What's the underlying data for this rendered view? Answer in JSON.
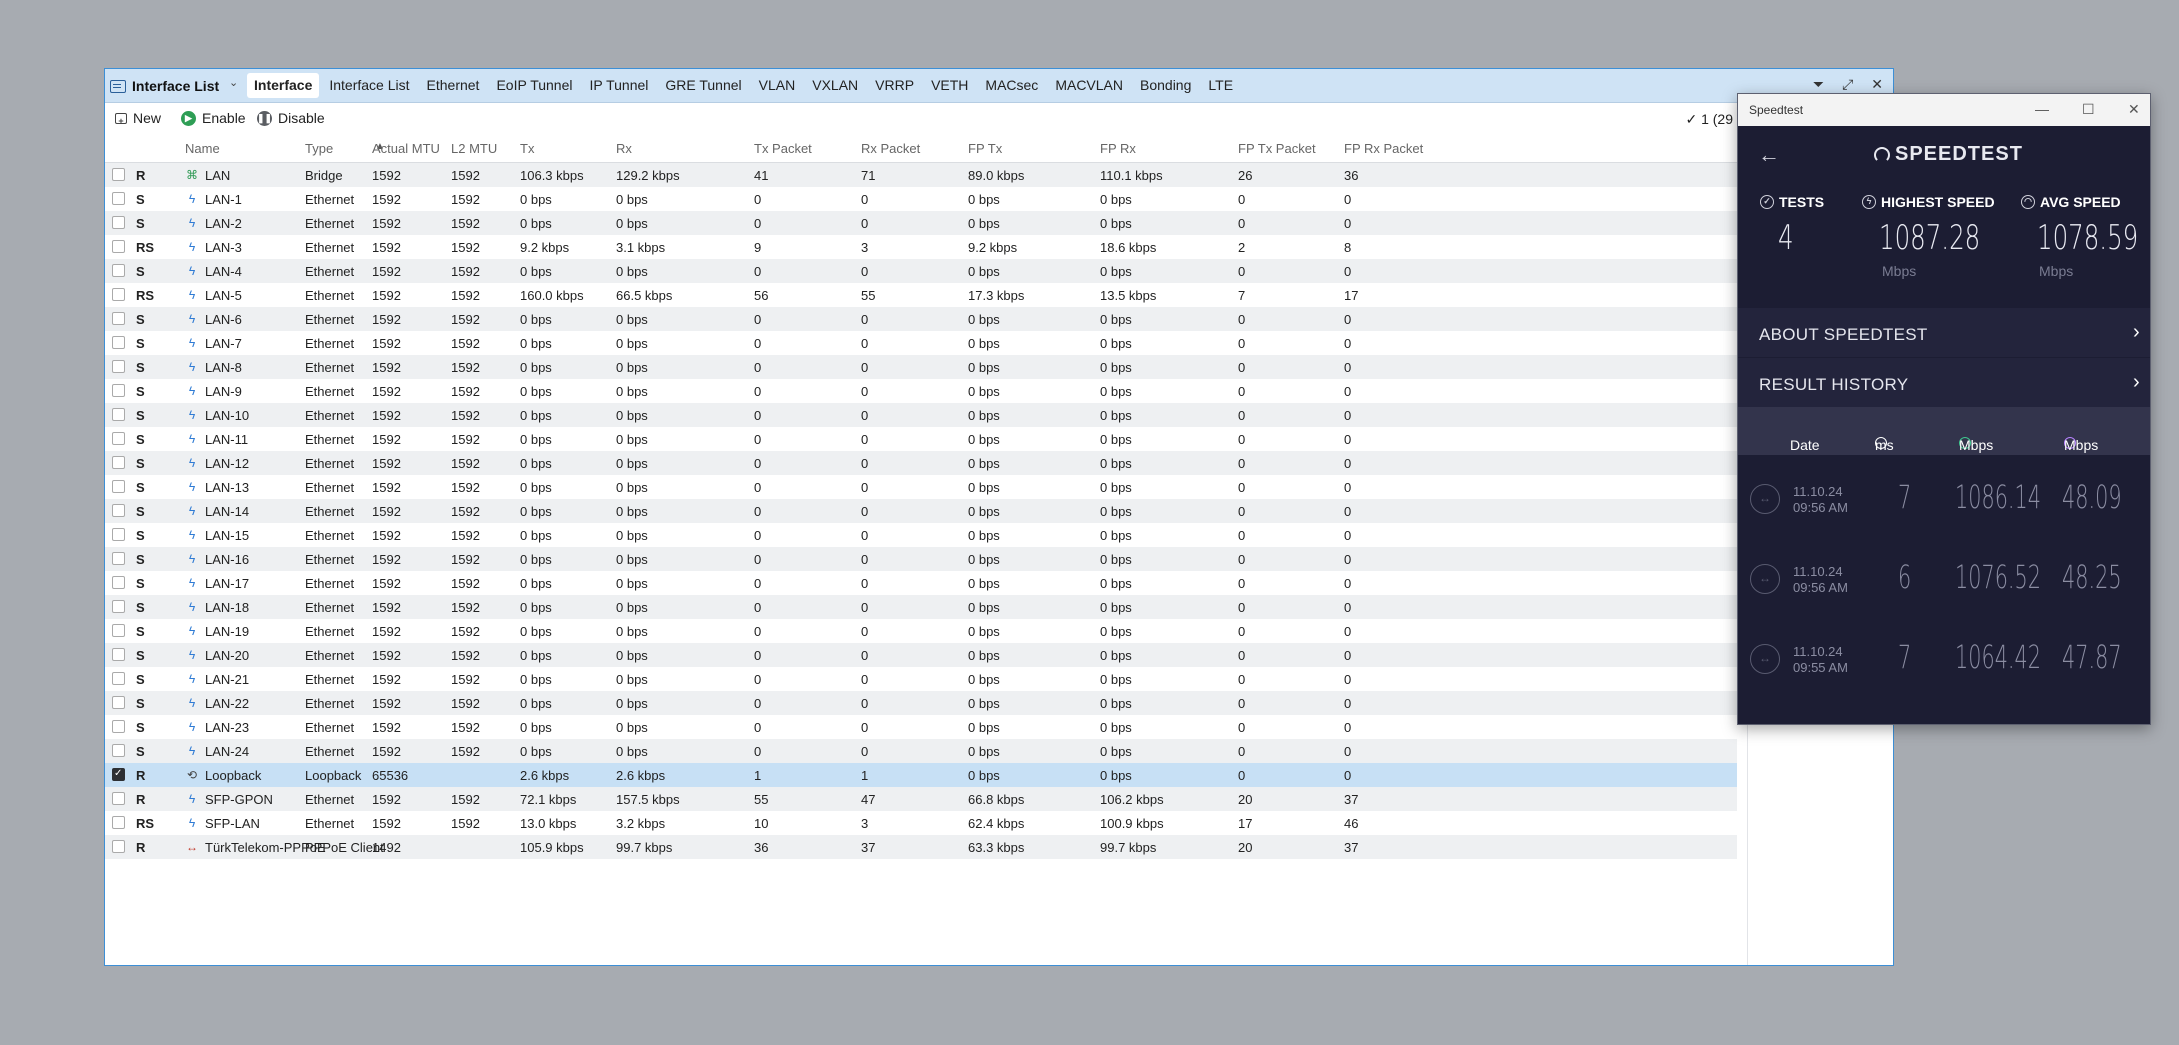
{
  "interface_window": {
    "title": "Interface List",
    "tabs": [
      "Interface",
      "Interface List",
      "Ethernet",
      "EoIP Tunnel",
      "IP Tunnel",
      "GRE Tunnel",
      "VLAN",
      "VXLAN",
      "VRRP",
      "VETH",
      "MACsec",
      "MACVLAN",
      "Bonding",
      "LTE"
    ],
    "active_tab": "Interface",
    "toolbar": {
      "new": "New",
      "enable": "Enable",
      "disable": "Disable",
      "count": "✓ 1 (29"
    },
    "columns": [
      "Name",
      "Type",
      "Actual MTU",
      "L2 MTU",
      "Tx",
      "Rx",
      "Tx Packet",
      "Rx Packet",
      "FP Tx",
      "FP Rx",
      "FP Tx Packet",
      "FP Rx Packet"
    ],
    "rows": [
      {
        "flags": "R",
        "icon": "bridge-icon",
        "name": "LAN",
        "type": "Bridge",
        "mtu": "1592",
        "l2": "1592",
        "tx": "106.3 kbps",
        "rx": "129.2 kbps",
        "txp": "41",
        "rxp": "71",
        "fptx": "89.0 kbps",
        "fprx": "110.1 kbps",
        "fptxp": "26",
        "fprxp": "36"
      },
      {
        "flags": "S",
        "icon": "ethernet-icon",
        "name": "LAN-1",
        "type": "Ethernet",
        "mtu": "1592",
        "l2": "1592",
        "tx": "0 bps",
        "rx": "0 bps",
        "txp": "0",
        "rxp": "0",
        "fptx": "0 bps",
        "fprx": "0 bps",
        "fptxp": "0",
        "fprxp": "0"
      },
      {
        "flags": "S",
        "icon": "ethernet-icon",
        "name": "LAN-2",
        "type": "Ethernet",
        "mtu": "1592",
        "l2": "1592",
        "tx": "0 bps",
        "rx": "0 bps",
        "txp": "0",
        "rxp": "0",
        "fptx": "0 bps",
        "fprx": "0 bps",
        "fptxp": "0",
        "fprxp": "0"
      },
      {
        "flags": "RS",
        "icon": "ethernet-icon",
        "name": "LAN-3",
        "type": "Ethernet",
        "mtu": "1592",
        "l2": "1592",
        "tx": "9.2 kbps",
        "rx": "3.1 kbps",
        "txp": "9",
        "rxp": "3",
        "fptx": "9.2 kbps",
        "fprx": "18.6 kbps",
        "fptxp": "2",
        "fprxp": "8"
      },
      {
        "flags": "S",
        "icon": "ethernet-icon",
        "name": "LAN-4",
        "type": "Ethernet",
        "mtu": "1592",
        "l2": "1592",
        "tx": "0 bps",
        "rx": "0 bps",
        "txp": "0",
        "rxp": "0",
        "fptx": "0 bps",
        "fprx": "0 bps",
        "fptxp": "0",
        "fprxp": "0"
      },
      {
        "flags": "RS",
        "icon": "ethernet-icon",
        "name": "LAN-5",
        "type": "Ethernet",
        "mtu": "1592",
        "l2": "1592",
        "tx": "160.0 kbps",
        "rx": "66.5 kbps",
        "txp": "56",
        "rxp": "55",
        "fptx": "17.3 kbps",
        "fprx": "13.5 kbps",
        "fptxp": "7",
        "fprxp": "17"
      },
      {
        "flags": "S",
        "icon": "ethernet-icon",
        "name": "LAN-6",
        "type": "Ethernet",
        "mtu": "1592",
        "l2": "1592",
        "tx": "0 bps",
        "rx": "0 bps",
        "txp": "0",
        "rxp": "0",
        "fptx": "0 bps",
        "fprx": "0 bps",
        "fptxp": "0",
        "fprxp": "0"
      },
      {
        "flags": "S",
        "icon": "ethernet-icon",
        "name": "LAN-7",
        "type": "Ethernet",
        "mtu": "1592",
        "l2": "1592",
        "tx": "0 bps",
        "rx": "0 bps",
        "txp": "0",
        "rxp": "0",
        "fptx": "0 bps",
        "fprx": "0 bps",
        "fptxp": "0",
        "fprxp": "0"
      },
      {
        "flags": "S",
        "icon": "ethernet-icon",
        "name": "LAN-8",
        "type": "Ethernet",
        "mtu": "1592",
        "l2": "1592",
        "tx": "0 bps",
        "rx": "0 bps",
        "txp": "0",
        "rxp": "0",
        "fptx": "0 bps",
        "fprx": "0 bps",
        "fptxp": "0",
        "fprxp": "0"
      },
      {
        "flags": "S",
        "icon": "ethernet-icon",
        "name": "LAN-9",
        "type": "Ethernet",
        "mtu": "1592",
        "l2": "1592",
        "tx": "0 bps",
        "rx": "0 bps",
        "txp": "0",
        "rxp": "0",
        "fptx": "0 bps",
        "fprx": "0 bps",
        "fptxp": "0",
        "fprxp": "0"
      },
      {
        "flags": "S",
        "icon": "ethernet-icon",
        "name": "LAN-10",
        "type": "Ethernet",
        "mtu": "1592",
        "l2": "1592",
        "tx": "0 bps",
        "rx": "0 bps",
        "txp": "0",
        "rxp": "0",
        "fptx": "0 bps",
        "fprx": "0 bps",
        "fptxp": "0",
        "fprxp": "0"
      },
      {
        "flags": "S",
        "icon": "ethernet-icon",
        "name": "LAN-11",
        "type": "Ethernet",
        "mtu": "1592",
        "l2": "1592",
        "tx": "0 bps",
        "rx": "0 bps",
        "txp": "0",
        "rxp": "0",
        "fptx": "0 bps",
        "fprx": "0 bps",
        "fptxp": "0",
        "fprxp": "0"
      },
      {
        "flags": "S",
        "icon": "ethernet-icon",
        "name": "LAN-12",
        "type": "Ethernet",
        "mtu": "1592",
        "l2": "1592",
        "tx": "0 bps",
        "rx": "0 bps",
        "txp": "0",
        "rxp": "0",
        "fptx": "0 bps",
        "fprx": "0 bps",
        "fptxp": "0",
        "fprxp": "0"
      },
      {
        "flags": "S",
        "icon": "ethernet-icon",
        "name": "LAN-13",
        "type": "Ethernet",
        "mtu": "1592",
        "l2": "1592",
        "tx": "0 bps",
        "rx": "0 bps",
        "txp": "0",
        "rxp": "0",
        "fptx": "0 bps",
        "fprx": "0 bps",
        "fptxp": "0",
        "fprxp": "0"
      },
      {
        "flags": "S",
        "icon": "ethernet-icon",
        "name": "LAN-14",
        "type": "Ethernet",
        "mtu": "1592",
        "l2": "1592",
        "tx": "0 bps",
        "rx": "0 bps",
        "txp": "0",
        "rxp": "0",
        "fptx": "0 bps",
        "fprx": "0 bps",
        "fptxp": "0",
        "fprxp": "0"
      },
      {
        "flags": "S",
        "icon": "ethernet-icon",
        "name": "LAN-15",
        "type": "Ethernet",
        "mtu": "1592",
        "l2": "1592",
        "tx": "0 bps",
        "rx": "0 bps",
        "txp": "0",
        "rxp": "0",
        "fptx": "0 bps",
        "fprx": "0 bps",
        "fptxp": "0",
        "fprxp": "0"
      },
      {
        "flags": "S",
        "icon": "ethernet-icon",
        "name": "LAN-16",
        "type": "Ethernet",
        "mtu": "1592",
        "l2": "1592",
        "tx": "0 bps",
        "rx": "0 bps",
        "txp": "0",
        "rxp": "0",
        "fptx": "0 bps",
        "fprx": "0 bps",
        "fptxp": "0",
        "fprxp": "0"
      },
      {
        "flags": "S",
        "icon": "ethernet-icon",
        "name": "LAN-17",
        "type": "Ethernet",
        "mtu": "1592",
        "l2": "1592",
        "tx": "0 bps",
        "rx": "0 bps",
        "txp": "0",
        "rxp": "0",
        "fptx": "0 bps",
        "fprx": "0 bps",
        "fptxp": "0",
        "fprxp": "0"
      },
      {
        "flags": "S",
        "icon": "ethernet-icon",
        "name": "LAN-18",
        "type": "Ethernet",
        "mtu": "1592",
        "l2": "1592",
        "tx": "0 bps",
        "rx": "0 bps",
        "txp": "0",
        "rxp": "0",
        "fptx": "0 bps",
        "fprx": "0 bps",
        "fptxp": "0",
        "fprxp": "0"
      },
      {
        "flags": "S",
        "icon": "ethernet-icon",
        "name": "LAN-19",
        "type": "Ethernet",
        "mtu": "1592",
        "l2": "1592",
        "tx": "0 bps",
        "rx": "0 bps",
        "txp": "0",
        "rxp": "0",
        "fptx": "0 bps",
        "fprx": "0 bps",
        "fptxp": "0",
        "fprxp": "0"
      },
      {
        "flags": "S",
        "icon": "ethernet-icon",
        "name": "LAN-20",
        "type": "Ethernet",
        "mtu": "1592",
        "l2": "1592",
        "tx": "0 bps",
        "rx": "0 bps",
        "txp": "0",
        "rxp": "0",
        "fptx": "0 bps",
        "fprx": "0 bps",
        "fptxp": "0",
        "fprxp": "0"
      },
      {
        "flags": "S",
        "icon": "ethernet-icon",
        "name": "LAN-21",
        "type": "Ethernet",
        "mtu": "1592",
        "l2": "1592",
        "tx": "0 bps",
        "rx": "0 bps",
        "txp": "0",
        "rxp": "0",
        "fptx": "0 bps",
        "fprx": "0 bps",
        "fptxp": "0",
        "fprxp": "0"
      },
      {
        "flags": "S",
        "icon": "ethernet-icon",
        "name": "LAN-22",
        "type": "Ethernet",
        "mtu": "1592",
        "l2": "1592",
        "tx": "0 bps",
        "rx": "0 bps",
        "txp": "0",
        "rxp": "0",
        "fptx": "0 bps",
        "fprx": "0 bps",
        "fptxp": "0",
        "fprxp": "0"
      },
      {
        "flags": "S",
        "icon": "ethernet-icon",
        "name": "LAN-23",
        "type": "Ethernet",
        "mtu": "1592",
        "l2": "1592",
        "tx": "0 bps",
        "rx": "0 bps",
        "txp": "0",
        "rxp": "0",
        "fptx": "0 bps",
        "fprx": "0 bps",
        "fptxp": "0",
        "fprxp": "0"
      },
      {
        "flags": "S",
        "icon": "ethernet-icon",
        "name": "LAN-24",
        "type": "Ethernet",
        "mtu": "1592",
        "l2": "1592",
        "tx": "0 bps",
        "rx": "0 bps",
        "txp": "0",
        "rxp": "0",
        "fptx": "0 bps",
        "fprx": "0 bps",
        "fptxp": "0",
        "fprxp": "0"
      },
      {
        "flags": "R",
        "icon": "loopback-icon",
        "name": "Loopback",
        "type": "Loopback",
        "mtu": "65536",
        "l2": "",
        "tx": "2.6 kbps",
        "rx": "2.6 kbps",
        "txp": "1",
        "rxp": "1",
        "fptx": "0 bps",
        "fprx": "0 bps",
        "fptxp": "0",
        "fprxp": "0",
        "selected": true
      },
      {
        "flags": "R",
        "icon": "ethernet-icon",
        "name": "SFP-GPON",
        "type": "Ethernet",
        "mtu": "1592",
        "l2": "1592",
        "tx": "72.1 kbps",
        "rx": "157.5 kbps",
        "txp": "55",
        "rxp": "47",
        "fptx": "66.8 kbps",
        "fprx": "106.2 kbps",
        "fptxp": "20",
        "fprxp": "37"
      },
      {
        "flags": "RS",
        "icon": "ethernet-icon",
        "name": "SFP-LAN",
        "type": "Ethernet",
        "mtu": "1592",
        "l2": "1592",
        "tx": "13.0 kbps",
        "rx": "3.2 kbps",
        "txp": "10",
        "rxp": "3",
        "fptx": "62.4 kbps",
        "fprx": "100.9 kbps",
        "fptxp": "17",
        "fprxp": "46"
      },
      {
        "flags": "R",
        "icon": "pppoe-icon",
        "name": "TürkTelekom-PPPoE",
        "type": "PPPoE Client",
        "mtu": "1492",
        "l2": "",
        "tx": "105.9 kbps",
        "rx": "99.7 kbps",
        "txp": "36",
        "rxp": "37",
        "fptx": "63.3 kbps",
        "fprx": "99.7 kbps",
        "fptxp": "20",
        "fprxp": "37"
      }
    ]
  },
  "speedtest_window": {
    "title": "Speedtest",
    "logo": "SPEEDTEST",
    "stats": {
      "tests_label": "TESTS",
      "tests_value": "4",
      "highest_label": "HIGHEST SPEED",
      "highest_value": "1087.28",
      "highest_unit": "Mbps",
      "avg_label": "AVG SPEED",
      "avg_value": "1078.59",
      "avg_unit": "Mbps"
    },
    "about": "ABOUT SPEEDTEST",
    "history": "RESULT HISTORY",
    "history_headers": {
      "date": "Date",
      "ping": "ms",
      "download": "Mbps",
      "upload": "Mbps"
    },
    "history_rows": [
      {
        "date": "11.10.24",
        "time": "09:56 AM",
        "ping": "7",
        "download": "1086.14",
        "upload": "48.09"
      },
      {
        "date": "11.10.24",
        "time": "09:56 AM",
        "ping": "6",
        "download": "1076.52",
        "upload": "48.25"
      },
      {
        "date": "11.10.24",
        "time": "09:55 AM",
        "ping": "7",
        "download": "1064.42",
        "upload": "47.87"
      }
    ],
    "colors": {
      "background": "#1c1d33",
      "download_accent": "#3ec78f",
      "upload_accent": "#b884ff"
    }
  }
}
